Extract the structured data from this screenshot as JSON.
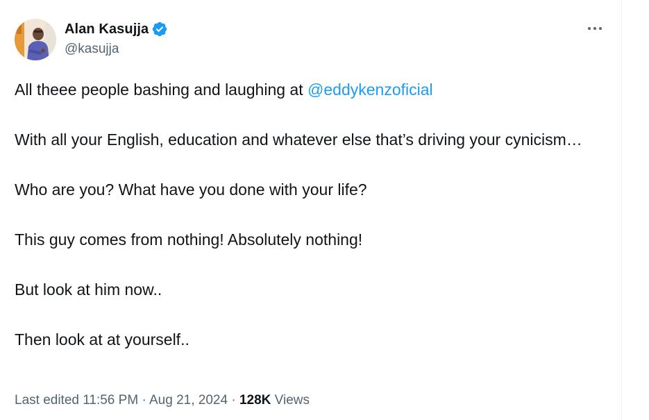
{
  "author": {
    "name": "Alan Kasujja",
    "handle": "@kasujja",
    "verified": true,
    "verified_color": "#1d9bf0",
    "avatar_icon": "profile-photo"
  },
  "more_icon": "ellipsis-icon",
  "tweet": {
    "line1_prefix": "All theee people bashing and laughing at ",
    "mention": "@eddykenzoficial",
    "paragraph2": "With all your English, education and whatever else that’s driving your cynicism…",
    "paragraph3": "Who are you? What have you done with your life?",
    "paragraph4": "This guy comes from nothing! Absolutely nothing!",
    "paragraph5": "But look at him now..",
    "paragraph6": "Then look at at yourself.."
  },
  "meta": {
    "edited_label": "Last edited 11:56 PM",
    "separator": "·",
    "date": "Aug 21, 2024",
    "views_count": "128K",
    "views_label": "Views"
  },
  "colors": {
    "text": "#0f1419",
    "secondary": "#536471",
    "link": "#1d9bf0"
  }
}
